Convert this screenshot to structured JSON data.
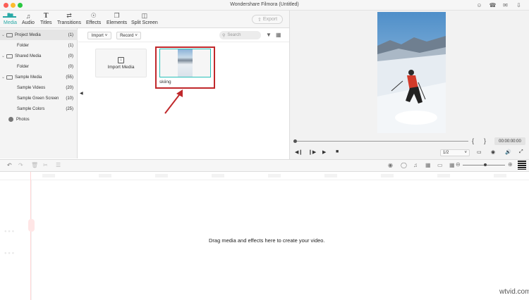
{
  "window": {
    "title": "Wondershare Filmora (Untitled)"
  },
  "tabs": [
    {
      "label": "Media",
      "icon": "folder-icon",
      "active": true
    },
    {
      "label": "Audio",
      "icon": "music-note-icon",
      "active": false
    },
    {
      "label": "Titles",
      "icon": "text-t-icon",
      "active": false
    },
    {
      "label": "Transitions",
      "icon": "transition-icon",
      "active": false
    },
    {
      "label": "Effects",
      "icon": "effects-icon",
      "active": false
    },
    {
      "label": "Elements",
      "icon": "elements-icon",
      "active": false
    },
    {
      "label": "Split Screen",
      "icon": "split-screen-icon",
      "active": false
    }
  ],
  "export_label": "Export",
  "sidebar": {
    "items": [
      {
        "label": "Project Media",
        "count": "(1)",
        "level": 0
      },
      {
        "label": "Folder",
        "count": "(1)",
        "level": 1
      },
      {
        "label": "Shared Media",
        "count": "(0)",
        "level": 0
      },
      {
        "label": "Folder",
        "count": "(0)",
        "level": 1
      },
      {
        "label": "Sample Media",
        "count": "(55)",
        "level": 0
      },
      {
        "label": "Sample Videos",
        "count": "(20)",
        "level": 1
      },
      {
        "label": "Sample Green Screen",
        "count": "(10)",
        "level": 1
      },
      {
        "label": "Sample Colors",
        "count": "(25)",
        "level": 1
      },
      {
        "label": "Photos",
        "count": "",
        "level": 0
      }
    ]
  },
  "media": {
    "import_dropdown": "Import",
    "record_dropdown": "Record",
    "search_placeholder": "Search",
    "import_card_label": "Import Media",
    "clip_name": "skiing"
  },
  "preview": {
    "timecode": "00:00:00:00",
    "ratio": "1/2"
  },
  "timeline": {
    "drop_hint": "Drag media and effects here to create your video."
  },
  "watermark": "wtvid.com",
  "colors": {
    "accent": "#28a9a6",
    "highlight_box": "#c0282b"
  }
}
